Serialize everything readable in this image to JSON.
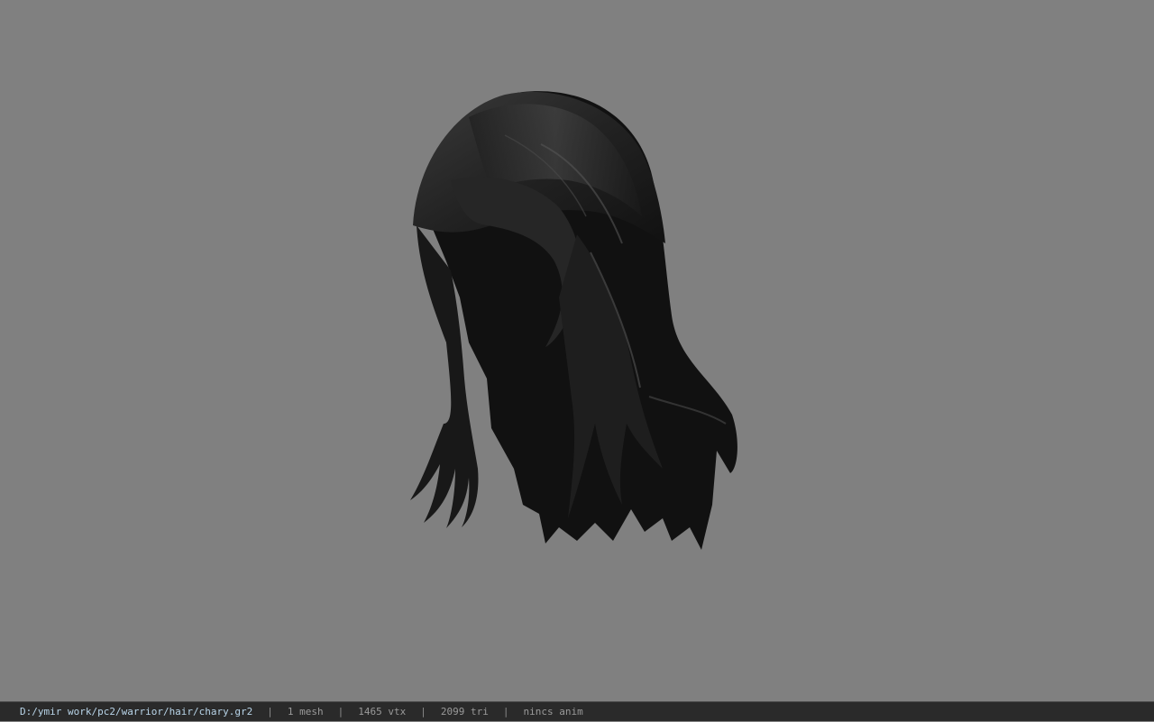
{
  "viewer": {
    "background_color": "#808080",
    "model_icon": "hair-mesh-model"
  },
  "status_bar": {
    "file_path": "D:/ymir work/pc2/warrior/hair/chary.gr2",
    "separator": "|",
    "mesh_count": "1 mesh",
    "vertex_count": "1465 vtx",
    "triangle_count": "2099 tri",
    "animation": "nincs anim"
  }
}
